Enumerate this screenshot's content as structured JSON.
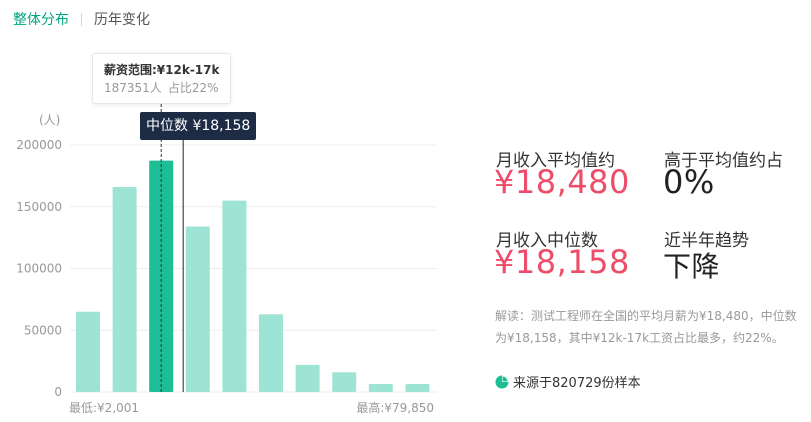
{
  "tabs": [
    {
      "label": "整体分布",
      "active": true
    },
    {
      "label": "历年变化",
      "active": false
    }
  ],
  "tooltip": {
    "title": "薪资范围:¥12k-17k",
    "count": "187351人",
    "share": "占比22%"
  },
  "median_marker": {
    "label": "中位数 ¥18,158"
  },
  "stats": {
    "avg_label": "月收入平均值约",
    "avg_value": "¥18,480",
    "above_label": "高于平均值约占",
    "above_value": "0%",
    "median_label": "月收入中位数",
    "median_value": "¥18,158",
    "trend_label": "近半年趋势",
    "trend_value": "下降"
  },
  "note": "解读：测试工程师在全国的平均月薪为¥18,480，中位数为¥18,158，其中¥12k-17k工资占比最多，约22%。",
  "source": {
    "icon": "pie-icon",
    "text": "来源于820729份样本"
  },
  "colors": {
    "bar": "#9de4d4",
    "bar_highlight": "#1dbd95",
    "accent_green": "#00a67e",
    "value_pink": "#ee4d6a",
    "marker_bg": "#1e2b45"
  },
  "chart_data": {
    "type": "bar",
    "ylabel": "(人)",
    "ylim": [
      0,
      200000
    ],
    "yticks": [
      "200000",
      "150000",
      "100000",
      "50000",
      "0"
    ],
    "x_min_label": "最低:¥2,001",
    "x_max_label": "最高:¥79,850",
    "values": [
      65000,
      166000,
      187351,
      134000,
      155000,
      63000,
      22000,
      16000,
      6500,
      6500
    ],
    "highlight_index": 2,
    "median_index": 2.6,
    "grid": true
  }
}
